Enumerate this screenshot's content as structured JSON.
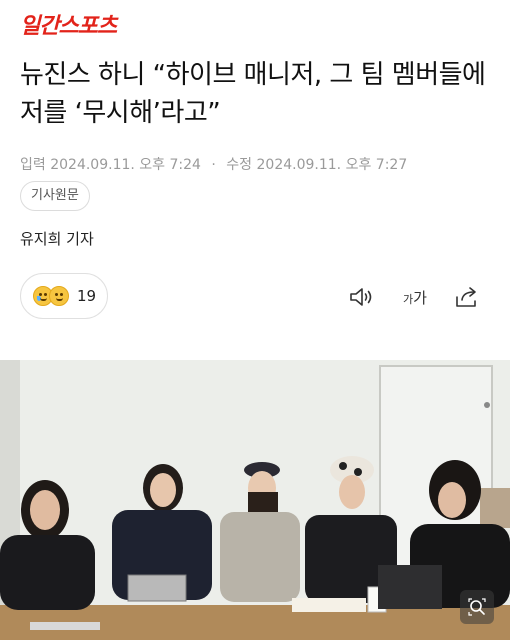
{
  "header": {
    "logo_text": "일간스포츠"
  },
  "article": {
    "title": "뉴진스 하니 “하이브 매니저, 그 팀 멤버들에 저를 ‘무시해’라고”",
    "input_label": "입력",
    "input_date": "2024.09.11. 오후 7:24",
    "separator": "·",
    "modified_label": "수정",
    "modified_date": "2024.09.11. 오후 7:27",
    "category": "기사원문",
    "author": "유지희 기자"
  },
  "toolbar": {
    "reaction_count": "19",
    "font_small": "가",
    "font_large": "가"
  },
  "colors": {
    "brand": "#e2231a",
    "meta_gray": "#9a9a9a"
  },
  "icons": [
    "sad-emoji-icon",
    "smile-emoji-icon",
    "speaker-icon",
    "font-size-icon",
    "share-icon",
    "zoom-icon"
  ]
}
